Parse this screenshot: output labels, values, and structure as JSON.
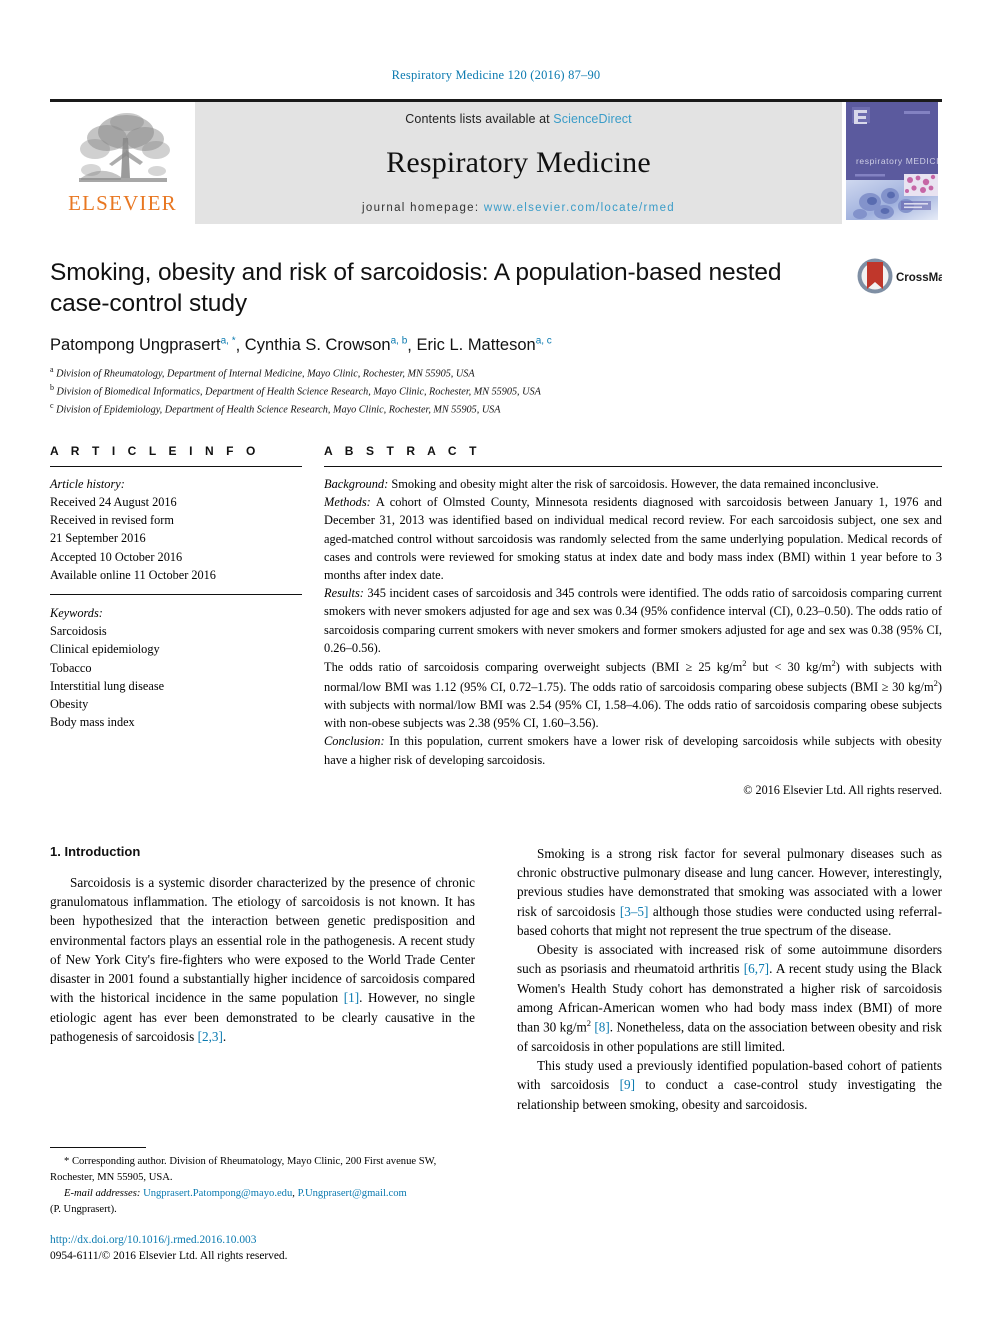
{
  "running_head": "Respiratory Medicine 120 (2016) 87–90",
  "banner": {
    "publisher_name": "ELSEVIER",
    "contents_prefix": "Contents lists available at",
    "contents_link": "ScienceDirect",
    "journal_name": "Respiratory Medicine",
    "homepage_prefix": "journal homepage:",
    "homepage_url": "www.elsevier.com/locate/rmed",
    "cover_title": "respiratory MEDICINE"
  },
  "article": {
    "title": "Smoking, obesity and risk of sarcoidosis: A population-based nested case-control study",
    "crossmark_label": "CrossMark",
    "authors": [
      {
        "name": "Patompong Ungprasert",
        "marks": "a, *"
      },
      {
        "name": "Cynthia S. Crowson",
        "marks": "a, b"
      },
      {
        "name": "Eric L. Matteson",
        "marks": "a, c"
      }
    ],
    "affiliations": [
      {
        "mark": "a",
        "text": "Division of Rheumatology, Department of Internal Medicine, Mayo Clinic, Rochester, MN 55905, USA"
      },
      {
        "mark": "b",
        "text": "Division of Biomedical Informatics, Department of Health Science Research, Mayo Clinic, Rochester, MN 55905, USA"
      },
      {
        "mark": "c",
        "text": "Division of Epidemiology, Department of Health Science Research, Mayo Clinic, Rochester, MN 55905, USA"
      }
    ]
  },
  "article_info": {
    "heading": "A R T I C L E   I N F O",
    "history_label": "Article history:",
    "history": [
      "Received 24 August 2016",
      "Received in revised form",
      "21 September 2016",
      "Accepted 10 October 2016",
      "Available online 11 October 2016"
    ],
    "keywords_label": "Keywords:",
    "keywords": [
      "Sarcoidosis",
      "Clinical epidemiology",
      "Tobacco",
      "Interstitial lung disease",
      "Obesity",
      "Body mass index"
    ]
  },
  "abstract": {
    "heading": "A B S T R A C T",
    "background_label": "Background:",
    "background_text": " Smoking and obesity might alter the risk of sarcoidosis. However, the data remained inconclusive.",
    "methods_label": "Methods:",
    "methods_text": " A cohort of Olmsted County, Minnesota residents diagnosed with sarcoidosis between January 1, 1976 and December 31, 2013 was identified based on individual medical record review. For each sarcoidosis subject, one sex and aged-matched control without sarcoidosis was randomly selected from the same underlying population. Medical records of cases and controls were reviewed for smoking status at index date and body mass index (BMI) within 1 year before to 3 months after index date.",
    "results_label": "Results:",
    "results_text_1": " 345 incident cases of sarcoidosis and 345 controls were identified. The odds ratio of sarcoidosis comparing current smokers with never smokers adjusted for age and sex was 0.34 (95% confidence interval (CI), 0.23–0.50). The odds ratio of sarcoidosis comparing current smokers with never smokers and former smokers adjusted for age and sex was 0.38 (95% CI, 0.26–0.56).",
    "results_text_2a": "The odds ratio of sarcoidosis comparing overweight subjects (BMI ≥ 25 kg/m",
    "results_text_2b": " but < 30 kg/m",
    "results_text_2c": ") with subjects with normal/low BMI was 1.12 (95% CI, 0.72–1.75). The odds ratio of sarcoidosis comparing obese subjects (BMI ≥ 30 kg/m",
    "results_text_2d": ") with subjects with normal/low BMI was 2.54 (95% CI, 1.58–4.06). The odds ratio of sarcoidosis comparing obese subjects with non-obese subjects was 2.38 (95% CI, 1.60–3.56).",
    "conclusion_label": "Conclusion:",
    "conclusion_text": " In this population, current smokers have a lower risk of developing sarcoidosis while subjects with obesity have a higher risk of developing sarcoidosis.",
    "copyright": "© 2016 Elsevier Ltd. All rights reserved."
  },
  "introduction": {
    "heading": "1. Introduction",
    "left_p1_a": "Sarcoidosis is a systemic disorder characterized by the presence of chronic granulomatous inflammation. The etiology of sarcoidosis is not known. It has been hypothesized that the interaction between genetic predisposition and environmental factors plays an essential role in the pathogenesis. A recent study of New York City's fire-fighters who were exposed to the World Trade Center disaster in 2001 found a substantially higher incidence of sarcoidosis compared with the historical incidence in the same population ",
    "left_p1_cite1": "[1]",
    "left_p1_b": ". However, no single etiologic agent has ever been demonstrated to be clearly causative in the pathogenesis of sarcoidosis ",
    "left_p1_cite2": "[2,3]",
    "left_p1_c": ".",
    "right_p1_a": "Smoking is a strong risk factor for several pulmonary diseases such as chronic obstructive pulmonary disease and lung cancer. However, interestingly, previous studies have demonstrated that smoking was associated with a lower risk of sarcoidosis ",
    "right_p1_cite": "[3–5]",
    "right_p1_b": " although those studies were conducted using referral-based cohorts that might not represent the true spectrum of the disease.",
    "right_p2_a": "Obesity is associated with increased risk of some autoimmune disorders such as psoriasis and rheumatoid arthritis ",
    "right_p2_cite1": "[6,7]",
    "right_p2_b": ". A recent study using the Black Women's Health Study cohort has demonstrated a higher risk of sarcoidosis among African-American women who had body mass index (BMI) of more than 30 kg/m",
    "right_p2_sup": "2",
    "right_p2_cite2": "[8]",
    "right_p2_c": ". Nonetheless, data on the association between obesity and risk of sarcoidosis in other populations are still limited.",
    "right_p3_a": "This study used a previously identified population-based cohort of patients with sarcoidosis ",
    "right_p3_cite": "[9]",
    "right_p3_b": " to conduct a case-control study investigating the relationship between smoking, obesity and sarcoidosis."
  },
  "footnote": {
    "corresponding_star": "*",
    "corresponding_text": " Corresponding author. Division of Rheumatology, Mayo Clinic, 200 First avenue SW, Rochester, MN 55905, USA.",
    "email_label": "E-mail addresses:",
    "email_1": "Ungprasert.Patompong@mayo.edu",
    "email_separator": ", ",
    "email_2": "P.Ungprasert@gmail.com",
    "email_attribution": "(P. Ungprasert)."
  },
  "bottom_matter": {
    "doi": "http://dx.doi.org/10.1016/j.rmed.2016.10.003",
    "issn_line": "0954-6111/© 2016 Elsevier Ltd. All rights reserved."
  },
  "colors": {
    "link_blue": "#0b7ab0",
    "sciencedirect_blue": "#3a9cc8",
    "elsevier_orange": "#e87722",
    "banner_gray": "#e3e3e3",
    "crossmark_red": "#c0372b",
    "cover_purple": "#5b5a9e"
  }
}
